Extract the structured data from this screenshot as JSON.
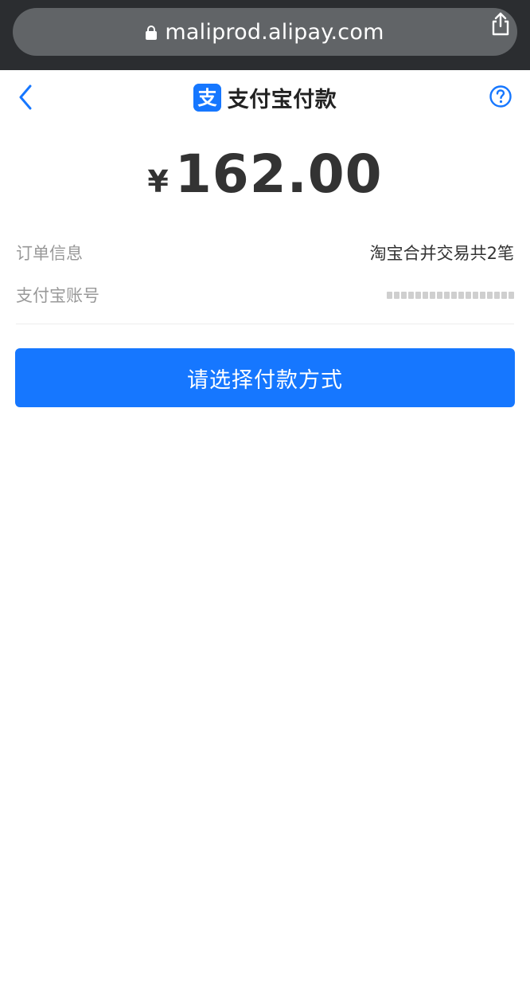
{
  "browser": {
    "url": "maliprod.alipay.com",
    "icons": {
      "lock": "lock-icon",
      "share": "share-icon"
    }
  },
  "nav": {
    "title": "支付宝付款",
    "logo_glyph": "支",
    "icons": {
      "back": "chevron-left-icon",
      "help": "help-circle-icon"
    }
  },
  "payment": {
    "currency_symbol": "¥",
    "amount": "162.00"
  },
  "info": {
    "order_label": "订单信息",
    "order_value": "淘宝合并交易共2笔",
    "account_label": "支付宝账号"
  },
  "action": {
    "pay_label": "请选择付款方式"
  },
  "colors": {
    "brand_blue": "#1677ff",
    "browser_bar": "#2b2d30",
    "url_pill": "#616467",
    "label_gray": "#999999",
    "text_dark": "#333333"
  }
}
